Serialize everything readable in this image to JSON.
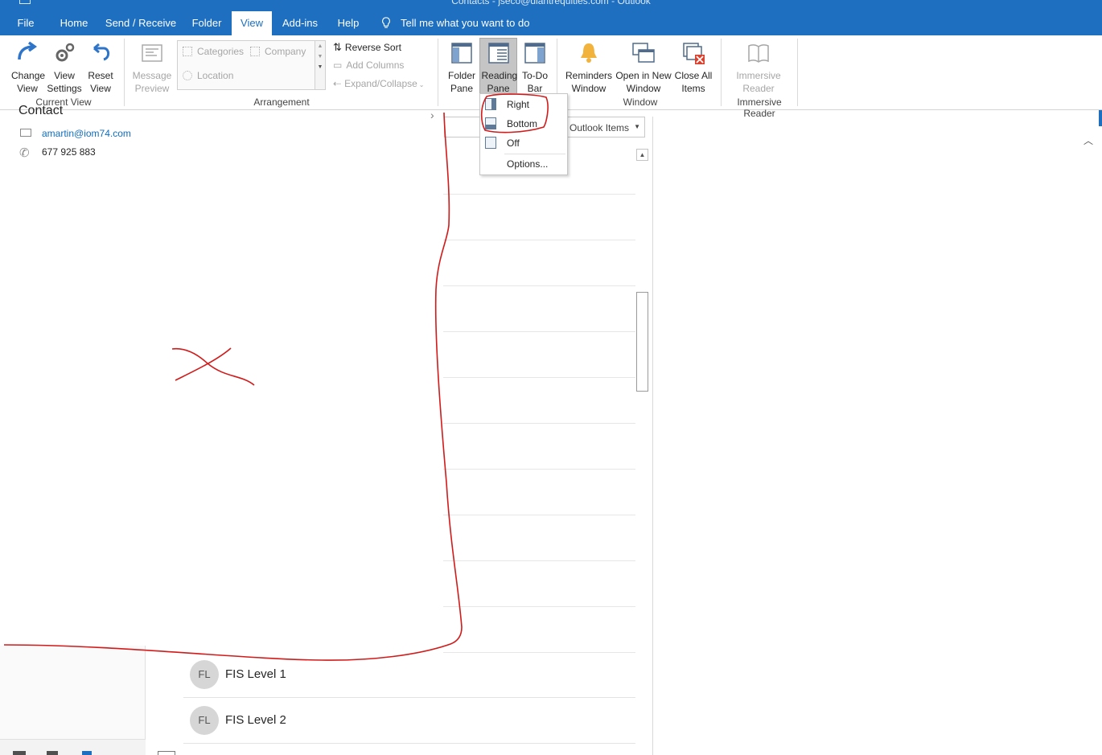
{
  "window": {
    "title": "Contacts - jseco@diantrequities.com - Outlook"
  },
  "tabs": [
    {
      "label": "File"
    },
    {
      "label": "Home"
    },
    {
      "label": "Send / Receive"
    },
    {
      "label": "Folder"
    },
    {
      "label": "View",
      "active": true
    },
    {
      "label": "Add-ins"
    },
    {
      "label": "Help"
    }
  ],
  "tellme": {
    "text": "Tell me what you want to do"
  },
  "ribbon": {
    "current_view": {
      "change_view": "Change View",
      "view_settings": "View Settings",
      "reset_view": "Reset View",
      "group_label": "Current View"
    },
    "arrangement": {
      "message_preview": "Message Preview",
      "categories": "Categories",
      "company": "Company",
      "location": "Location",
      "reverse_sort": "Reverse Sort",
      "add_columns": "Add Columns",
      "expand_collapse": "Expand/Collapse",
      "group_label": "Arrangement"
    },
    "layout": {
      "folder_pane": "Folder Pane",
      "reading_pane": "Reading Pane",
      "todo_bar": "To-Do Bar"
    },
    "window": {
      "reminders": "Reminders Window",
      "open_new": "Open in New Window",
      "close_all": "Close All Items",
      "group_label": "Window"
    },
    "immersive": {
      "reader": "Immersive Reader",
      "group_label": "Immersive Reader"
    }
  },
  "reading_pane_menu": {
    "right": "Right",
    "bottom": "Bottom",
    "off": "Off",
    "options": "Options..."
  },
  "contact": {
    "heading": "Contact",
    "email": "amartin@iom74.com",
    "phone": "677 925 883"
  },
  "list": {
    "filter": "Outlook Items",
    "people": [
      {
        "initials": "FL",
        "name": "FIS Level 1"
      },
      {
        "initials": "FL",
        "name": "FIS Level 2"
      }
    ]
  },
  "colors": {
    "accent": "#1e6fc0",
    "annotation": "#d11a1a"
  }
}
